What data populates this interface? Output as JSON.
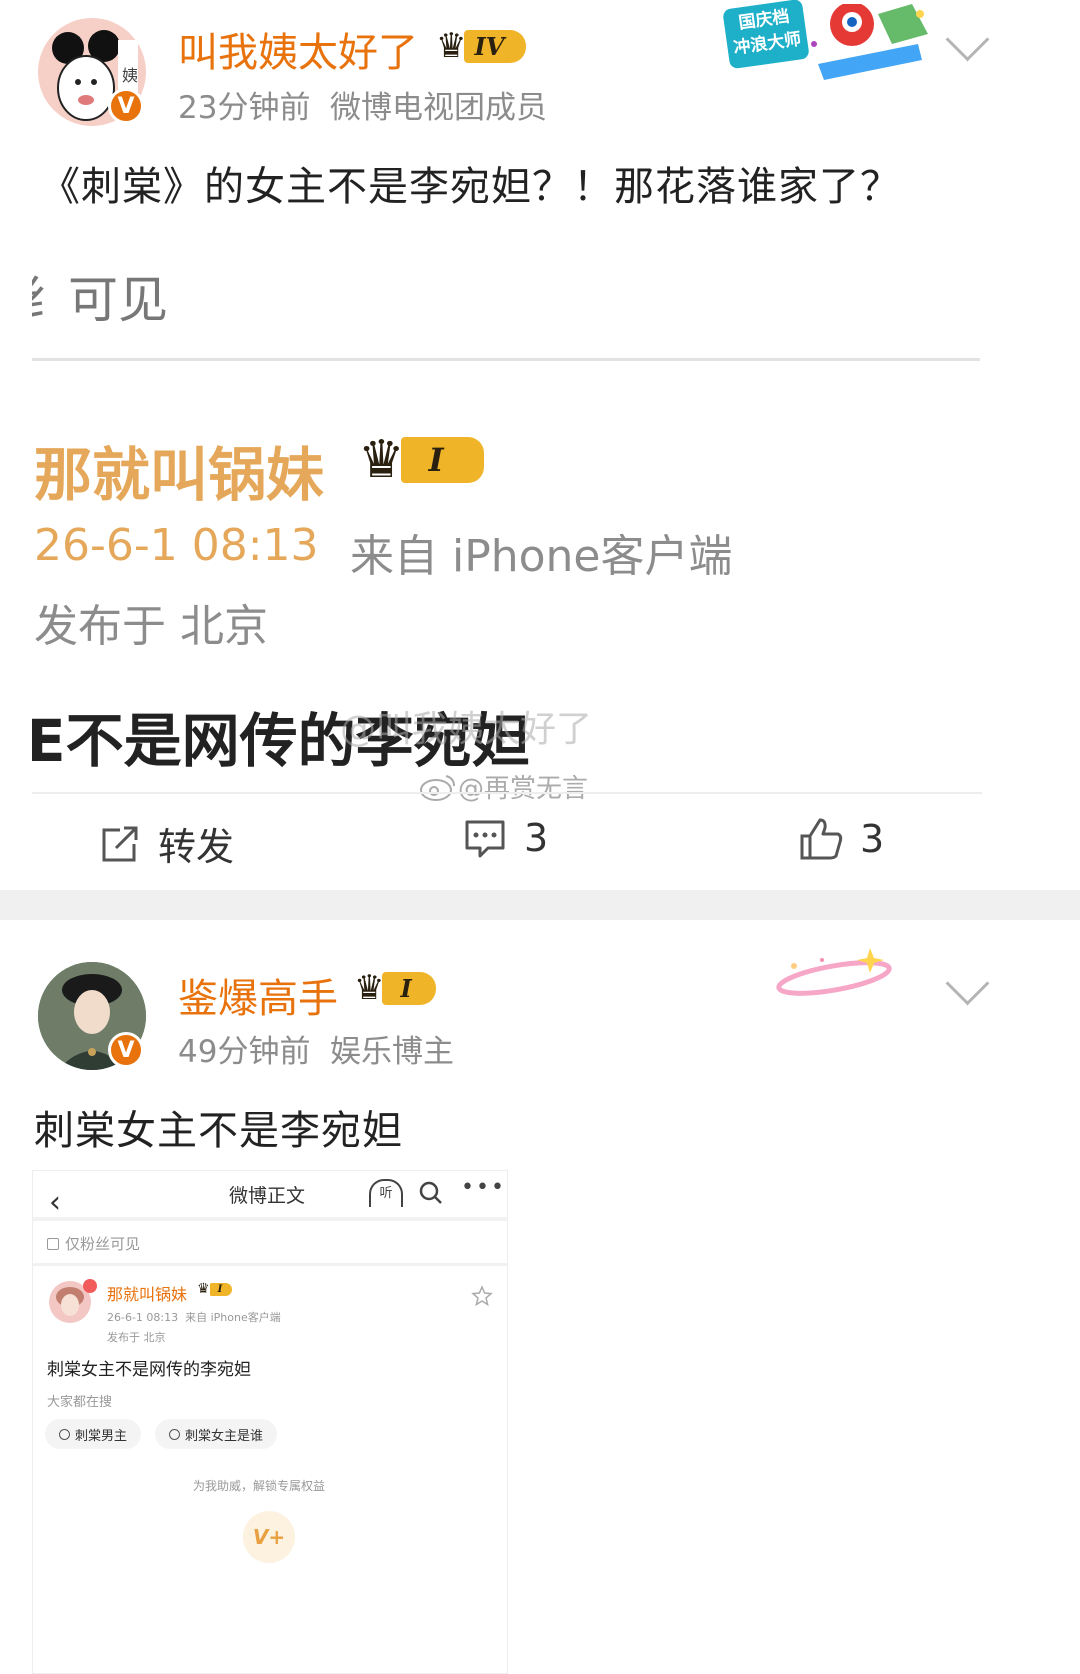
{
  "post1": {
    "username": "叫我姨太好了",
    "level": "IV",
    "time": "23分钟前",
    "role": "微博电视团成员",
    "text": "《刺棠》的女主不是李宛妲？！那花落谁家了？",
    "promo_line1": "国庆档",
    "promo_line2": "冲浪大师",
    "avatar_glyph": "姨",
    "verified_mark": "V",
    "quoted": {
      "visibility_fragment": "纟可见",
      "username": "那就叫锅妹",
      "level": "I",
      "datetime": "26-6-1 08:13",
      "source": "来自 iPhone客户端",
      "location": "发布于 北京",
      "text_fragment": "E不是网传的李宛妲",
      "watermark1": "@叫我姨太好了",
      "watermark2": "@再赏无言"
    },
    "actions": {
      "repost_label": "转发",
      "comment_count": "3",
      "like_count": "3"
    }
  },
  "post2": {
    "username": "鉴爆高手",
    "level": "I",
    "time": "49分钟前",
    "role": "娱乐博主",
    "text": "刺棠女主不是李宛妲",
    "verified_mark": "V",
    "embedded": {
      "nav_title": "微博正文",
      "listen_label": "听",
      "visibility": "仅粉丝可见",
      "username": "那就叫锅妹",
      "level": "I",
      "meta": "26-6-1 08:13  来自 iPhone客户端",
      "location": "发布于 北京",
      "text": "刺棠女主不是网传的李宛妲",
      "search_heading": "大家都在搜",
      "chips": [
        "刺棠男主",
        "刺棠女主是谁"
      ],
      "support_text": "为我助威，解锁专属权益",
      "support_icon": "V+"
    }
  },
  "colors": {
    "accent": "#e8720c",
    "gold": "#f0b428",
    "divider": "#f0f0f0"
  }
}
